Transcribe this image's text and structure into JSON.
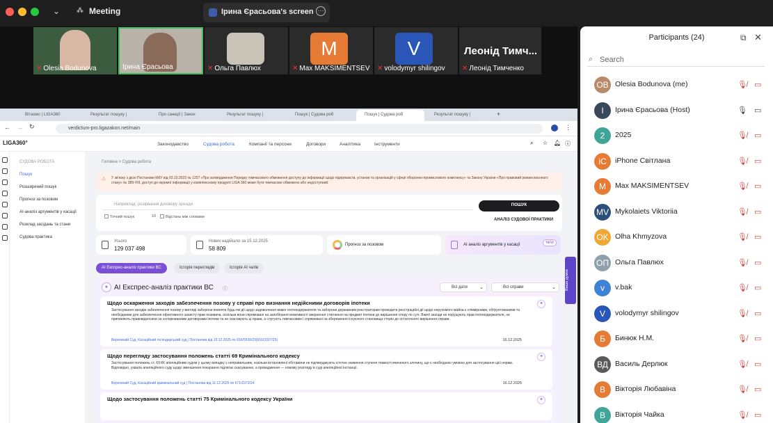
{
  "window": {
    "meeting": "Meeting",
    "share_tab": "Ірина Єрасьова's screen"
  },
  "video": {
    "tiles": [
      {
        "name": "Olesia Bodunova"
      },
      {
        "name": "Ірина Єрасьова"
      },
      {
        "name": "Ольга Павлюх"
      },
      {
        "name": "Max MAKSIMENTSEV",
        "initial": "M",
        "color": "#e67b35"
      },
      {
        "name": "volodymyr shilingov",
        "initial": "V",
        "color": "#2a56b8"
      },
      {
        "name": "Леонід Тимченко",
        "big": "Леонід Тимч..."
      }
    ]
  },
  "browser": {
    "tabs": [
      "Вітаємо | LIGA360",
      "Результат пошуку |",
      "Про санкції | Закон",
      "Результат пошуку |",
      "Пошук | Судова роб",
      "Пошук | Судова роб",
      "Результат пошуку |"
    ],
    "url": "verdictum-pro.ligazakon.net/main"
  },
  "site": {
    "logo": "LIGA360°",
    "nav": [
      "Законодавство",
      "Судова робота",
      "Компанії та персони",
      "Договори",
      "Аналітика",
      "Інструменти"
    ]
  },
  "sidebar": {
    "heading": "СУДОВА РОБОТА",
    "items": [
      "Пошук",
      "Розширений пошук",
      "Прогноз за позовом",
      "AI-аналіз аргументів у касації",
      "Розклад засідань та стани",
      "Судова практика"
    ]
  },
  "main": {
    "breadcrumb": "Головна > Судова робота",
    "notice": "У зв'язку з дією Постанови КМУ від 03.10.2023 № 1257 «Про затвердження Порядку тимчасового обмеження доступу до інформації щодо підприємств, установ та організацій у сфері оборонно-промислового комплексу» та Закону України «Про правовий режим воєнного стану» № 389-VIII, доступ до окремої інформації у комплексному продукті LIGA 360 може бути тимчасово обмежено або недоступний.",
    "search_placeholder": "Наприклад: розірвання договору оренди",
    "exact": "Точний пошук",
    "distance_num": "10",
    "distance": "Відстань між словами",
    "search_btn": "ПОШУК",
    "analysis_btn": "АНАЛІЗ СУДОВОЇ ПРАКТИКИ",
    "stats": {
      "all_label": "Усього",
      "all_value": "129 037 498",
      "new_label": "Нових надійшло за 15.12.2025",
      "new_value": "58 809",
      "forecast": "Прогноз за позовом",
      "ai": "AI аналіз аргументів у касації",
      "new_badge": "NEW"
    },
    "pills": [
      "AI Експрес-аналіз практики ВС",
      "Історія переглядів",
      "Історія AI чатів"
    ],
    "express_title": "AI Експрес-аналіз практики ВС",
    "dates": "Всі дати",
    "cases": "Всі справи",
    "results": [
      {
        "title": "Щодо оскарження заходів забезпечення позову у справі про визнання недійсними договорів іпотеки",
        "body": "Застосування заходів забезпечення позову у вигляді заборони вчиняти будь-які дії щодо задоволення вимог іпотекодержателя та заборони державним реєстраторам проводити реєстраційні дії щодо нерухомого майна є співмірними, обґрунтованими та необхідними для забезпечення ефективного захисту прав позивача, оскільки вони спрямовані на запобігання можливості звернення стягнення на предмет іпотеки до вирішення спору по суті. Вжиті заходи не порушують прав іпотекодержателя, не припиняють правовідносини за оспорюваними договорами іпотеки та не скасовують ці права, а слугують тимчасовим і спрямовані на збереження існуючого становища сторін до остаточного вирішення справи.",
        "src": "Верховний Суд, Касаційний господарський суд | Постанова від 15.12.2025 по 916/5530/23(916/3327/25)",
        "date": "16.12.2025"
      },
      {
        "title": "Щодо перегляду застосування положень статті 69 Кримінального кодексу",
        "body": "Застосування положень ст. 69 КК апеляційним судом у цьому випадку є неправильним, оскільки встановлені обставини не підтверджують істотне зниження ступеня тяжкості вчиненого злочину, що є необхідною умовою для застосування цієї норми. Відповідно, ухвала апеляційного суду щодо зменшення покарання підлягає скасуванню, а провадження — новому розгляду в суді апеляційної інстанції.",
        "src": "Верховний Суд, Касаційний кримінальний суд | Постанова від 11.12.2025 по 671/2373/24",
        "date": "16.12.2025"
      },
      {
        "title": "Щодо застосування положень статті 75 Кримінального кодексу України",
        "body": "",
        "src": "",
        "date": ""
      }
    ]
  },
  "feedback": "Ваша думка",
  "participants": {
    "title": "Participants (24)",
    "search": "Search",
    "list": [
      {
        "name": "Olesia Bodunova (me)",
        "initial": "OB",
        "color": "#b78a6a",
        "mic": "off",
        "cam": "off"
      },
      {
        "name": "Ірина Єрасьова (Host)",
        "initial": "І",
        "color": "#39485a",
        "mic": "on",
        "cam": "on"
      },
      {
        "name": "2025",
        "initial": "2",
        "color": "#3fa596",
        "mic": "off",
        "cam": "off"
      },
      {
        "name": "iPhone Світлана",
        "initial": "iC",
        "color": "#e67b35",
        "mic": "off",
        "cam": "off"
      },
      {
        "name": "Max MAKSIMENTSEV",
        "initial": "M",
        "color": "#e67b35",
        "mic": "off",
        "cam": "off"
      },
      {
        "name": "Mykolaiets Viktoriia",
        "initial": "MV",
        "color": "#2c4f7a",
        "mic": "off",
        "cam": "off"
      },
      {
        "name": "Olha Khmyzova",
        "initial": "OK",
        "color": "#f0a835",
        "mic": "off",
        "cam": "off"
      },
      {
        "name": "Ольга Павлюх",
        "initial": "ОП",
        "color": "#8fa0ad",
        "mic": "off",
        "cam": "off"
      },
      {
        "name": "v.bak",
        "initial": "v",
        "color": "#3e82d6",
        "mic": "off",
        "cam": "off"
      },
      {
        "name": "volodymyr shilingov",
        "initial": "V",
        "color": "#2a56b8",
        "mic": "off",
        "cam": "off"
      },
      {
        "name": "Бинюк Н.М.",
        "initial": "Б",
        "color": "#e67b35",
        "mic": "off",
        "cam": "off"
      },
      {
        "name": "Василь Дерлюк",
        "initial": "ВД",
        "color": "#5a5a5a",
        "mic": "off",
        "cam": "off"
      },
      {
        "name": "Вікторія Любавіна",
        "initial": "В",
        "color": "#e67b35",
        "mic": "off",
        "cam": "off"
      },
      {
        "name": "Вікторія Чайка",
        "initial": "В",
        "color": "#3fa596",
        "mic": "off",
        "cam": "off"
      }
    ]
  }
}
